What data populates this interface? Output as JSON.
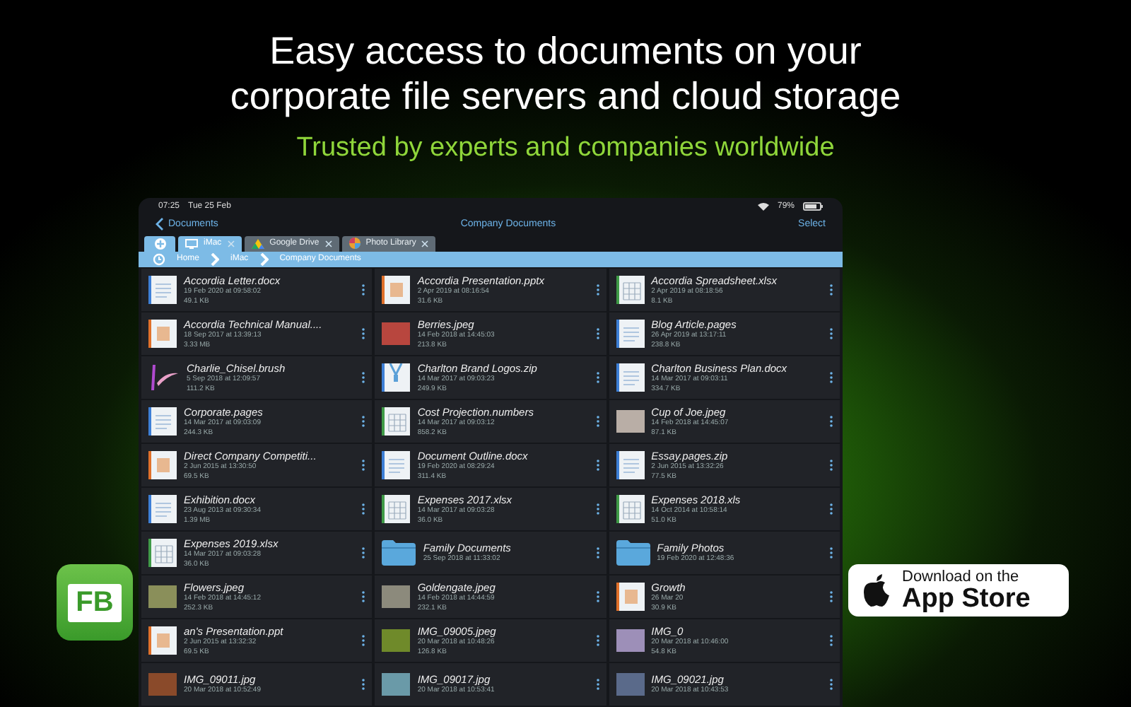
{
  "headline": {
    "lines": [
      "Easy access to documents on your",
      "corporate file servers and cloud storage"
    ],
    "subtitle": "Trusted by experts and companies worldwide"
  },
  "status_bar": {
    "time": "07:25",
    "date": "Tue 25 Feb",
    "battery": "79%"
  },
  "nav": {
    "back": "Documents",
    "title": "Company Documents",
    "action": "Select"
  },
  "tabs": [
    {
      "label": "iMac",
      "kind": "computer",
      "selected": true
    },
    {
      "label": "Google Drive",
      "kind": "drive",
      "selected": false
    },
    {
      "label": "Photo Library",
      "kind": "photos",
      "selected": false
    }
  ],
  "breadcrumb": [
    "Home",
    "iMac",
    "Company Documents"
  ],
  "files": [
    {
      "name": "Accordia Letter.docx",
      "date": "19 Feb 2020 at 09:58:02",
      "size": "49.1 KB",
      "kind": "doc"
    },
    {
      "name": "Accordia Presentation.pptx",
      "date": "2 Apr 2019 at 08:16:54",
      "size": "31.6 KB",
      "kind": "pres"
    },
    {
      "name": "Accordia Spreadsheet.xlsx",
      "date": "2 Apr 2019 at 08:18:56",
      "size": "8.1 KB",
      "kind": "sheet"
    },
    {
      "name": "Accordia Technical Manual....",
      "date": "18 Sep 2017 at 13:39:13",
      "size": "3.33 MB",
      "kind": "pres"
    },
    {
      "name": "Berries.jpeg",
      "date": "14 Feb 2018 at 14:45:03",
      "size": "213.8 KB",
      "kind": "photo",
      "color": "#b8463e"
    },
    {
      "name": "Blog Article.pages",
      "date": "26 Apr 2019 at 13:17:11",
      "size": "238.8 KB",
      "kind": "doc"
    },
    {
      "name": "Charlie_Chisel.brush",
      "date": "5 Sep 2018 at 12:09:57",
      "size": "111.2 KB",
      "kind": "brush"
    },
    {
      "name": "Charlton Brand Logos.zip",
      "date": "14 Mar 2017 at 09:03:23",
      "size": "249.9 KB",
      "kind": "zip"
    },
    {
      "name": "Charlton Business Plan.docx",
      "date": "14 Mar 2017 at 09:03:11",
      "size": "334.7 KB",
      "kind": "doc"
    },
    {
      "name": "Corporate.pages",
      "date": "14 Mar 2017 at 09:03:09",
      "size": "244.3 KB",
      "kind": "doc"
    },
    {
      "name": "Cost Projection.numbers",
      "date": "14 Mar 2017 at 09:03:12",
      "size": "858.2 KB",
      "kind": "sheet"
    },
    {
      "name": "Cup of Joe.jpeg",
      "date": "14 Feb 2018 at 14:45:07",
      "size": "87.1 KB",
      "kind": "photo",
      "color": "#b9aea6"
    },
    {
      "name": "Direct Company Competiti...",
      "date": "2 Jun 2015 at 13:30:50",
      "size": "69.5 KB",
      "kind": "pres"
    },
    {
      "name": "Document Outline.docx",
      "date": "19 Feb 2020 at 08:29:24",
      "size": "311.4 KB",
      "kind": "doc"
    },
    {
      "name": "Essay.pages.zip",
      "date": "2 Jun 2015 at 13:32:26",
      "size": "77.5 KB",
      "kind": "doc"
    },
    {
      "name": "Exhibition.docx",
      "date": "23 Aug 2013 at 09:30:34",
      "size": "1.39 MB",
      "kind": "doc"
    },
    {
      "name": "Expenses 2017.xlsx",
      "date": "14 Mar 2017 at 09:03:28",
      "size": "36.0 KB",
      "kind": "sheet"
    },
    {
      "name": "Expenses 2018.xls",
      "date": "14 Oct 2014 at 10:58:14",
      "size": "51.0 KB",
      "kind": "sheet"
    },
    {
      "name": "Expenses 2019.xlsx",
      "date": "14 Mar 2017 at 09:03:28",
      "size": "36.0 KB",
      "kind": "sheet"
    },
    {
      "name": "Family Documents",
      "date": "25 Sep 2018 at 11:33:02",
      "kind": "folder"
    },
    {
      "name": "Family Photos",
      "date": "19 Feb 2020 at 12:48:36",
      "kind": "folder"
    },
    {
      "name": "Flowers.jpeg",
      "date": "14 Feb 2018 at 14:45:12",
      "size": "252.3 KB",
      "kind": "photo",
      "color": "#8a8f5a"
    },
    {
      "name": "Goldengate.jpeg",
      "date": "14 Feb 2018 at 14:44:59",
      "size": "232.1 KB",
      "kind": "photo",
      "color": "#8c8a7c"
    },
    {
      "name": "Growth",
      "date": "26 Mar 20",
      "size": "30.9 KB",
      "kind": "pres"
    },
    {
      "name": "an's Presentation.ppt",
      "date": "2 Jun 2015 at 13:32:32",
      "size": "69.5 KB",
      "kind": "pres"
    },
    {
      "name": "IMG_09005.jpeg",
      "date": "20 Mar 2018 at 10:48:26",
      "size": "126.8 KB",
      "kind": "photo",
      "color": "#6f8a2a"
    },
    {
      "name": "IMG_0",
      "date": "20 Mar 2018 at 10:46:00",
      "size": "54.8 KB",
      "kind": "photo",
      "color": "#9d8fb8"
    },
    {
      "name": "IMG_09011.jpg",
      "date": "20 Mar 2018 at 10:52:49",
      "kind": "photo",
      "color": "#8a4a2a"
    },
    {
      "name": "IMG_09017.jpg",
      "date": "20 Mar 2018 at 10:53:41",
      "kind": "photo",
      "color": "#6a9aa8"
    },
    {
      "name": "IMG_09021.jpg",
      "date": "20 Mar 2018 at 10:43:53",
      "kind": "photo",
      "color": "#5a6a8a"
    }
  ],
  "app_logo": {
    "text": "FB"
  },
  "store_badge": {
    "line1": "Download on the",
    "line2": "App Store"
  }
}
